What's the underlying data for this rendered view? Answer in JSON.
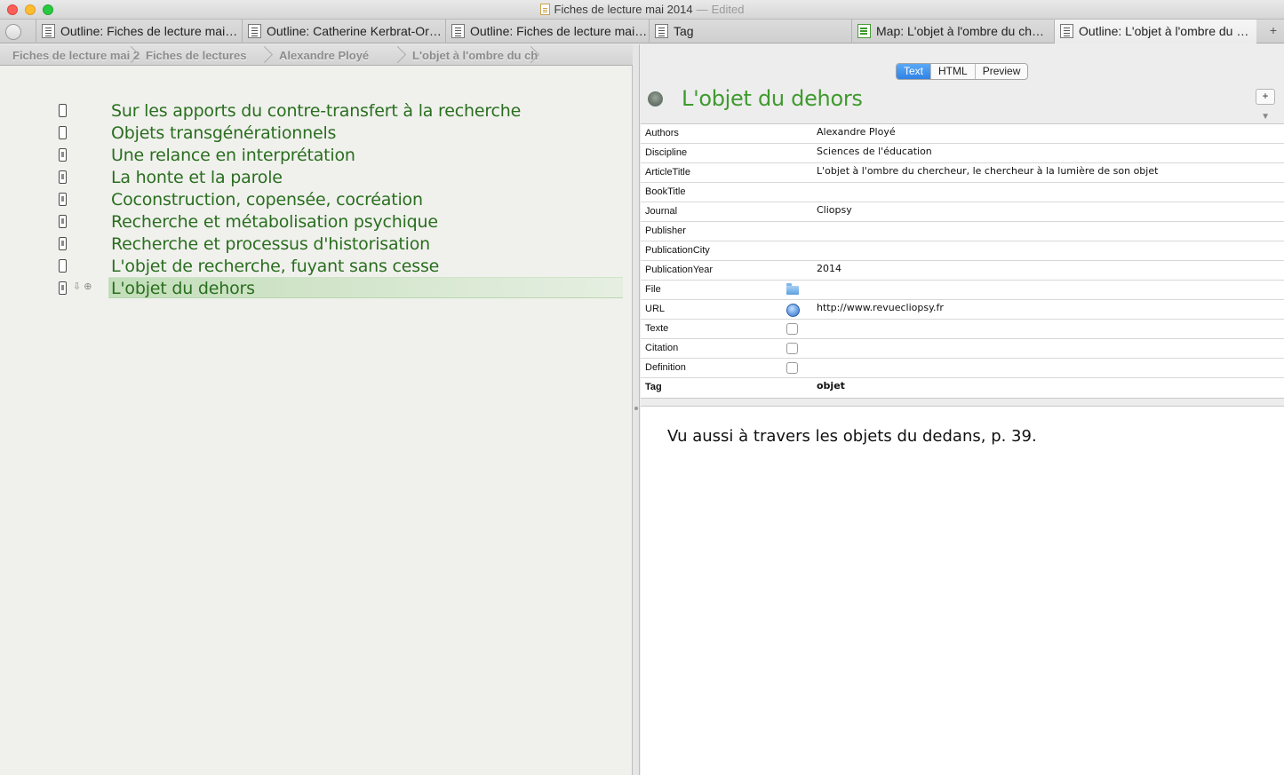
{
  "window": {
    "title": "Fiches de lecture mai 2014",
    "status": "Edited"
  },
  "tabs": [
    {
      "label": "Outline: Fiches de lecture mai…",
      "icon": "outline-doc-icon"
    },
    {
      "label": "Outline: Catherine Kerbrat-Or…",
      "icon": "outline-doc-icon"
    },
    {
      "label": "Outline: Fiches de lecture mai…",
      "icon": "outline-doc-icon"
    },
    {
      "label": "Tag",
      "icon": "outline-doc-icon"
    },
    {
      "label": "Map: L'objet à l'ombre du ch…",
      "icon": "map-icon"
    },
    {
      "label": "Outline: L'objet à l'ombre du …",
      "icon": "outline-doc-icon"
    }
  ],
  "new_tab_label": "+",
  "breadcrumb": [
    "Fiches de lecture mai 2",
    "Fiches de lectures",
    "Alexandre Ployé",
    "L'objet à l'ombre du ch"
  ],
  "outline": {
    "items": [
      {
        "label": "Sur les apports du contre-transfert à la recherche",
        "has_text": false
      },
      {
        "label": "Objets transgénérationnels",
        "has_text": false
      },
      {
        "label": "Une relance en interprétation",
        "has_text": true
      },
      {
        "label": "La honte et la parole",
        "has_text": true
      },
      {
        "label": "Coconstruction, copensée, cocréation",
        "has_text": true
      },
      {
        "label": "Recherche et métabolisation psychique",
        "has_text": true
      },
      {
        "label": "Recherche et processus d'historisation",
        "has_text": true
      },
      {
        "label": "L'objet de recherche, fuyant sans cesse",
        "has_text": false
      },
      {
        "label": "L'objet du dehors",
        "has_text": true,
        "selected": true
      }
    ],
    "row_tools": "⇩ ⊕"
  },
  "view_modes": {
    "text": "Text",
    "html": "HTML",
    "preview": "Preview",
    "selected": "Text"
  },
  "note": {
    "title": "L'objet du dehors",
    "add_label": "+",
    "collapse_label": "▼",
    "attributes": [
      {
        "key": "Authors",
        "value": "Alexandre Ployé"
      },
      {
        "key": "Discipline",
        "value": "Sciences de l'éducation"
      },
      {
        "key": "ArticleTitle",
        "value": "L'objet à l'ombre du chercheur, le chercheur à la lumière de son objet"
      },
      {
        "key": "BookTitle",
        "value": ""
      },
      {
        "key": "Journal",
        "value": "Cliopsy"
      },
      {
        "key": "Publisher",
        "value": ""
      },
      {
        "key": "PublicationCity",
        "value": ""
      },
      {
        "key": "PublicationYear",
        "value": "2014"
      },
      {
        "key": "File",
        "value": "",
        "control": "folder-icon"
      },
      {
        "key": "URL",
        "value": "http://www.revuecliopsy.fr",
        "control": "globe-icon"
      },
      {
        "key": "Texte",
        "value": "",
        "control": "checkbox",
        "checked": false
      },
      {
        "key": "Citation",
        "value": "",
        "control": "checkbox",
        "checked": false
      },
      {
        "key": "Definition",
        "value": "",
        "control": "checkbox",
        "checked": false
      },
      {
        "key": "Tag",
        "value": "objet",
        "bold": true
      }
    ],
    "body": "Vu aussi à travers les objets du dedans, p. 39."
  },
  "colors": {
    "accent_green": "#3f9a2e",
    "outline_text": "#2a6e1f",
    "segment_active": "#2f83e6"
  }
}
